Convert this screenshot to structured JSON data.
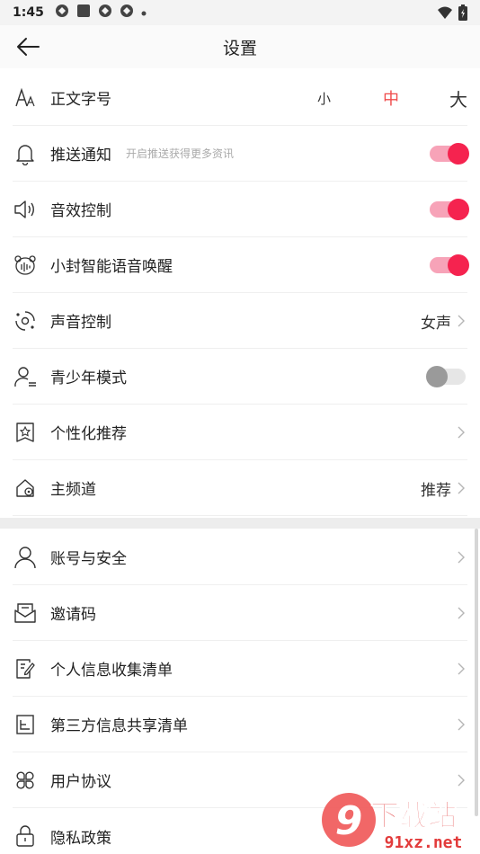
{
  "status_bar": {
    "time": "1:45"
  },
  "app_bar": {
    "title": "设置"
  },
  "section1": [
    {
      "key": "font_size",
      "label": "正文字号",
      "icon": "font-size-icon",
      "sizes": [
        "小",
        "中",
        "大"
      ],
      "selected": "中"
    },
    {
      "key": "push",
      "label": "推送通知",
      "sub": "开启推送获得更多资讯",
      "icon": "bell-icon",
      "toggle": true
    },
    {
      "key": "sound",
      "label": "音效控制",
      "icon": "speaker-icon",
      "toggle": true
    },
    {
      "key": "wake",
      "label": "小封智能语音唤醒",
      "icon": "voice-assistant-icon",
      "toggle": true
    },
    {
      "key": "voice",
      "label": "声音控制",
      "value": "女声",
      "icon": "voice-control-icon"
    },
    {
      "key": "teen",
      "label": "青少年模式",
      "icon": "teen-mode-icon",
      "toggle": false
    },
    {
      "key": "personal",
      "label": "个性化推荐",
      "icon": "star-bookmark-icon"
    },
    {
      "key": "channel",
      "label": "主频道",
      "value": "推荐",
      "icon": "home-channel-icon"
    }
  ],
  "section2": [
    {
      "key": "account",
      "label": "账号与安全",
      "icon": "user-icon"
    },
    {
      "key": "invite",
      "label": "邀请码",
      "icon": "envelope-icon"
    },
    {
      "key": "collect",
      "label": "个人信息收集清单",
      "icon": "document-edit-icon"
    },
    {
      "key": "share",
      "label": "第三方信息共享清单",
      "icon": "list-document-icon"
    },
    {
      "key": "agreement",
      "label": "用户协议",
      "icon": "grid-clover-icon"
    },
    {
      "key": "privacy",
      "label": "隐私政策",
      "icon": "lock-icon"
    }
  ],
  "watermark": {
    "brand": "下载站",
    "domain": "91xz.net"
  },
  "colors": {
    "accent": "#f5234f",
    "accent_light": "#f7a3b8",
    "selected_size": "#f04b4b"
  }
}
